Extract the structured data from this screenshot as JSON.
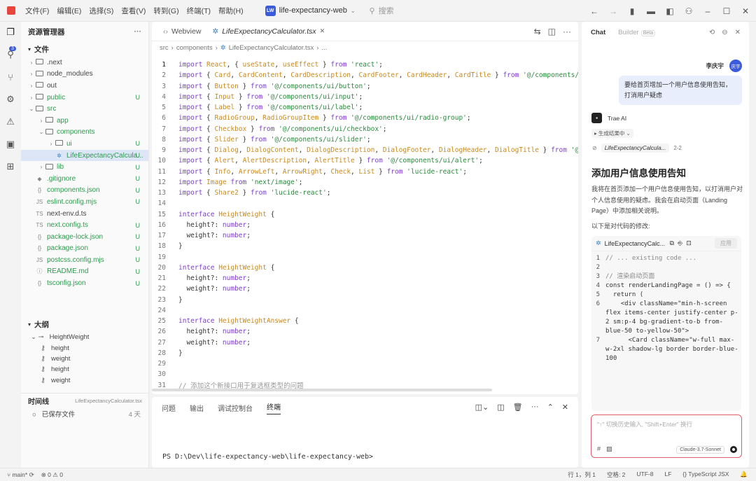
{
  "titlebar": {
    "menus": [
      "文件(F)",
      "编辑(E)",
      "选择(S)",
      "查看(V)",
      "转到(G)",
      "终端(T)",
      "帮助(H)"
    ],
    "project_badge": "LW",
    "project_name": "life-expectancy-web",
    "search_placeholder": "搜索"
  },
  "activity": {
    "badge": "3"
  },
  "sidebar": {
    "title": "资源管理器",
    "files_section": "文件",
    "tree": [
      {
        "name": ".next",
        "type": "folder",
        "indent": 0,
        "status": "",
        "green": false,
        "selected": false
      },
      {
        "name": "node_modules",
        "type": "folder",
        "indent": 0,
        "status": "",
        "green": false,
        "selected": false
      },
      {
        "name": "out",
        "type": "folder",
        "indent": 0,
        "status": "",
        "green": false,
        "selected": false
      },
      {
        "name": "public",
        "type": "folder",
        "indent": 0,
        "status": "U",
        "green": true,
        "selected": false
      },
      {
        "name": "src",
        "type": "folder-open",
        "indent": 0,
        "status": "",
        "green": true,
        "selected": false
      },
      {
        "name": "app",
        "type": "folder",
        "indent": 1,
        "status": "",
        "green": true,
        "selected": false
      },
      {
        "name": "components",
        "type": "folder-open",
        "indent": 1,
        "status": "",
        "green": true,
        "selected": false
      },
      {
        "name": "ui",
        "type": "folder",
        "indent": 2,
        "status": "U",
        "green": true,
        "selected": false
      },
      {
        "name": "LifeExpectancyCalcula...",
        "type": "tsx",
        "indent": 2,
        "status": "U",
        "green": true,
        "selected": true
      },
      {
        "name": "lib",
        "type": "folder",
        "indent": 1,
        "status": "U",
        "green": true,
        "selected": false
      },
      {
        "name": ".gitignore",
        "type": "git",
        "indent": 0,
        "status": "U",
        "green": true,
        "selected": false
      },
      {
        "name": "components.json",
        "type": "json",
        "indent": 0,
        "status": "U",
        "green": true,
        "selected": false
      },
      {
        "name": "eslint.config.mjs",
        "type": "js",
        "indent": 0,
        "status": "U",
        "green": true,
        "selected": false
      },
      {
        "name": "next-env.d.ts",
        "type": "ts",
        "indent": 0,
        "status": "",
        "green": false,
        "selected": false
      },
      {
        "name": "next.config.ts",
        "type": "ts",
        "indent": 0,
        "status": "U",
        "green": true,
        "selected": false
      },
      {
        "name": "package-lock.json",
        "type": "json",
        "indent": 0,
        "status": "U",
        "green": true,
        "selected": false
      },
      {
        "name": "package.json",
        "type": "json",
        "indent": 0,
        "status": "U",
        "green": true,
        "selected": false
      },
      {
        "name": "postcss.config.mjs",
        "type": "js",
        "indent": 0,
        "status": "U",
        "green": true,
        "selected": false
      },
      {
        "name": "README.md",
        "type": "info",
        "indent": 0,
        "status": "U",
        "green": true,
        "selected": false
      },
      {
        "name": "tsconfig.json",
        "type": "json",
        "indent": 0,
        "status": "U",
        "green": true,
        "selected": false
      }
    ],
    "outline_title": "大纲",
    "outline": [
      {
        "name": "HeightWeight",
        "kind": "interface"
      },
      {
        "name": "height",
        "kind": "prop"
      },
      {
        "name": "weight",
        "kind": "prop"
      },
      {
        "name": "height",
        "kind": "prop"
      },
      {
        "name": "weight",
        "kind": "prop"
      }
    ],
    "timeline_title": "时间线",
    "timeline_file": "LifeExpectancyCalculator.tsx",
    "timeline_entry": "已保存文件",
    "timeline_time": "4 天"
  },
  "editor": {
    "tabs": [
      {
        "label": "Webview",
        "active": false
      },
      {
        "label": "LifeExpectancyCalculator.tsx",
        "active": true
      }
    ],
    "breadcrumb": [
      "src",
      "components",
      "LifeExpectancyCalculator.tsx",
      "..."
    ],
    "lines": [
      {
        "n": "1",
        "tokens": [
          [
            "kw",
            "import "
          ],
          [
            "id",
            "React"
          ],
          [
            "pl",
            ", { "
          ],
          [
            "id",
            "useState"
          ],
          [
            "pl",
            ", "
          ],
          [
            "id",
            "useEffect"
          ],
          [
            "pl",
            " } "
          ],
          [
            "kw",
            "from "
          ],
          [
            "st",
            "'react'"
          ],
          [
            "pl",
            ";"
          ]
        ]
      },
      {
        "n": "2",
        "tokens": [
          [
            "kw",
            "import "
          ],
          [
            "pl",
            "{ "
          ],
          [
            "id",
            "Card"
          ],
          [
            "pl",
            ", "
          ],
          [
            "id",
            "CardContent"
          ],
          [
            "pl",
            ", "
          ],
          [
            "id",
            "CardDescription"
          ],
          [
            "pl",
            ", "
          ],
          [
            "id",
            "CardFooter"
          ],
          [
            "pl",
            ", "
          ],
          [
            "id",
            "CardHeader"
          ],
          [
            "pl",
            ", "
          ],
          [
            "id",
            "CardTitle"
          ],
          [
            "pl",
            " } "
          ],
          [
            "kw",
            "from "
          ],
          [
            "st",
            "'@/components/ui"
          ]
        ]
      },
      {
        "n": "3",
        "tokens": [
          [
            "kw",
            "import "
          ],
          [
            "pl",
            "{ "
          ],
          [
            "id",
            "Button"
          ],
          [
            "pl",
            " } "
          ],
          [
            "kw",
            "from "
          ],
          [
            "st",
            "'@/components/ui/button'"
          ],
          [
            "pl",
            ";"
          ]
        ]
      },
      {
        "n": "4",
        "tokens": [
          [
            "kw",
            "import "
          ],
          [
            "pl",
            "{ "
          ],
          [
            "id",
            "Input"
          ],
          [
            "pl",
            " } "
          ],
          [
            "kw",
            "from "
          ],
          [
            "st",
            "'@/components/ui/input'"
          ],
          [
            "pl",
            ";"
          ]
        ]
      },
      {
        "n": "5",
        "tokens": [
          [
            "kw",
            "import "
          ],
          [
            "pl",
            "{ "
          ],
          [
            "id",
            "Label"
          ],
          [
            "pl",
            " } "
          ],
          [
            "kw",
            "from "
          ],
          [
            "st",
            "'@/components/ui/label'"
          ],
          [
            "pl",
            ";"
          ]
        ]
      },
      {
        "n": "6",
        "tokens": [
          [
            "kw",
            "import "
          ],
          [
            "pl",
            "{ "
          ],
          [
            "id",
            "RadioGroup"
          ],
          [
            "pl",
            ", "
          ],
          [
            "id",
            "RadioGroupItem"
          ],
          [
            "pl",
            " } "
          ],
          [
            "kw",
            "from "
          ],
          [
            "st",
            "'@/components/ui/radio-group'"
          ],
          [
            "pl",
            ";"
          ]
        ]
      },
      {
        "n": "7",
        "tokens": [
          [
            "kw",
            "import "
          ],
          [
            "pl",
            "{ "
          ],
          [
            "id",
            "Checkbox"
          ],
          [
            "pl",
            " } "
          ],
          [
            "kw",
            "from "
          ],
          [
            "st",
            "'@/components/ui/checkbox'"
          ],
          [
            "pl",
            ";"
          ]
        ]
      },
      {
        "n": "8",
        "tokens": [
          [
            "kw",
            "import "
          ],
          [
            "pl",
            "{ "
          ],
          [
            "id",
            "Slider"
          ],
          [
            "pl",
            " } "
          ],
          [
            "kw",
            "from "
          ],
          [
            "st",
            "'@/components/ui/slider'"
          ],
          [
            "pl",
            ";"
          ]
        ]
      },
      {
        "n": "9",
        "tokens": [
          [
            "kw",
            "import "
          ],
          [
            "pl",
            "{ "
          ],
          [
            "id",
            "Dialog"
          ],
          [
            "pl",
            ", "
          ],
          [
            "id",
            "DialogContent"
          ],
          [
            "pl",
            ", "
          ],
          [
            "id",
            "DialogDescription"
          ],
          [
            "pl",
            ", "
          ],
          [
            "id",
            "DialogFooter"
          ],
          [
            "pl",
            ", "
          ],
          [
            "id",
            "DialogHeader"
          ],
          [
            "pl",
            ", "
          ],
          [
            "id",
            "DialogTitle"
          ],
          [
            "pl",
            " } "
          ],
          [
            "kw",
            "from "
          ],
          [
            "st",
            "'@/c"
          ]
        ]
      },
      {
        "n": "10",
        "tokens": [
          [
            "kw",
            "import "
          ],
          [
            "pl",
            "{ "
          ],
          [
            "id",
            "Alert"
          ],
          [
            "pl",
            ", "
          ],
          [
            "id",
            "AlertDescription"
          ],
          [
            "pl",
            ", "
          ],
          [
            "id",
            "AlertTitle"
          ],
          [
            "pl",
            " } "
          ],
          [
            "kw",
            "from "
          ],
          [
            "st",
            "'@/components/ui/alert'"
          ],
          [
            "pl",
            ";"
          ]
        ]
      },
      {
        "n": "11",
        "tokens": [
          [
            "kw",
            "import "
          ],
          [
            "pl",
            "{ "
          ],
          [
            "id",
            "Info"
          ],
          [
            "pl",
            ", "
          ],
          [
            "id",
            "ArrowLeft"
          ],
          [
            "pl",
            ", "
          ],
          [
            "id",
            "ArrowRight"
          ],
          [
            "pl",
            ", "
          ],
          [
            "id",
            "Check"
          ],
          [
            "pl",
            ", "
          ],
          [
            "id",
            "List"
          ],
          [
            "pl",
            " } "
          ],
          [
            "kw",
            "from "
          ],
          [
            "st",
            "'lucide-react'"
          ],
          [
            "pl",
            ";"
          ]
        ]
      },
      {
        "n": "12",
        "tokens": [
          [
            "kw",
            "import "
          ],
          [
            "id",
            "Image "
          ],
          [
            "kw",
            "from "
          ],
          [
            "st",
            "'next/image'"
          ],
          [
            "pl",
            ";"
          ]
        ]
      },
      {
        "n": "13",
        "tokens": [
          [
            "kw",
            "import "
          ],
          [
            "pl",
            "{ "
          ],
          [
            "id",
            "Share2"
          ],
          [
            "pl",
            " } "
          ],
          [
            "kw",
            "from "
          ],
          [
            "st",
            "'lucide-react'"
          ],
          [
            "pl",
            ";"
          ]
        ]
      },
      {
        "n": "14",
        "tokens": []
      },
      {
        "n": "15",
        "tokens": [
          [
            "kw",
            "interface "
          ],
          [
            "id",
            "HeightWeight"
          ],
          [
            "pl",
            " {"
          ]
        ]
      },
      {
        "n": "16",
        "tokens": [
          [
            "pl",
            "  height?: "
          ],
          [
            "ty",
            "number"
          ],
          [
            "pl",
            ";"
          ]
        ]
      },
      {
        "n": "17",
        "tokens": [
          [
            "pl",
            "  weight?: "
          ],
          [
            "ty",
            "number"
          ],
          [
            "pl",
            ";"
          ]
        ]
      },
      {
        "n": "18",
        "tokens": [
          [
            "pl",
            "}"
          ]
        ]
      },
      {
        "n": "19",
        "tokens": []
      },
      {
        "n": "20",
        "tokens": [
          [
            "kw",
            "interface "
          ],
          [
            "id",
            "HeightWeight"
          ],
          [
            "pl",
            " {"
          ]
        ]
      },
      {
        "n": "21",
        "tokens": [
          [
            "pl",
            "  height?: "
          ],
          [
            "ty",
            "number"
          ],
          [
            "pl",
            ";"
          ]
        ]
      },
      {
        "n": "22",
        "tokens": [
          [
            "pl",
            "  weight?: "
          ],
          [
            "ty",
            "number"
          ],
          [
            "pl",
            ";"
          ]
        ]
      },
      {
        "n": "23",
        "tokens": [
          [
            "pl",
            "}"
          ]
        ]
      },
      {
        "n": "24",
        "tokens": []
      },
      {
        "n": "25",
        "tokens": [
          [
            "kw",
            "interface "
          ],
          [
            "id",
            "HeightWeightAnswer"
          ],
          [
            "pl",
            " {"
          ]
        ]
      },
      {
        "n": "26",
        "tokens": [
          [
            "pl",
            "  height?: "
          ],
          [
            "ty",
            "number"
          ],
          [
            "pl",
            ";"
          ]
        ]
      },
      {
        "n": "27",
        "tokens": [
          [
            "pl",
            "  weight?: "
          ],
          [
            "ty",
            "number"
          ],
          [
            "pl",
            ";"
          ]
        ]
      },
      {
        "n": "28",
        "tokens": [
          [
            "pl",
            "}"
          ]
        ]
      },
      {
        "n": "29",
        "tokens": []
      },
      {
        "n": "30",
        "tokens": []
      },
      {
        "n": "31",
        "tokens": [
          [
            "cm",
            "// 添加这个新接口用于复选框类型的问题"
          ]
        ]
      }
    ]
  },
  "panel": {
    "tabs": [
      "问题",
      "输出",
      "调试控制台",
      "终端"
    ],
    "active_tab": "终端",
    "prompt": "PS D:\\Dev\\life-expectancy-web\\life-expectancy-web>"
  },
  "chat": {
    "tab_chat": "Chat",
    "tab_builder": "Builder",
    "beta": "Beta",
    "user_name": "李庆宇",
    "user_avatar": "庆宇",
    "user_message": "要给首页增加一个用户信息使用告知，打消用户疑虑",
    "ai_name": "Trae AI",
    "generating": "生成结果中",
    "file_ref": "LifeExpectancyCalcula...",
    "file_ref_lines": "2-2",
    "heading": "添加用户信息使用告知",
    "para": "我将在首页添加一个用户信息使用告知，以打消用户对个人信息使用的疑虑。我会在启动页面（Landing Page）中添加相关说明。",
    "para2": "以下是对代码的修改:",
    "code_title": "LifeExpectancyCalc...",
    "apply": "应用",
    "code_lines": [
      {
        "n": "1",
        "text": "// ... existing code ..."
      },
      {
        "n": "2",
        "text": ""
      },
      {
        "n": "3",
        "text": "// 渲染启动页面"
      },
      {
        "n": "4",
        "text": "const renderLandingPage = () => {"
      },
      {
        "n": "5",
        "text": "  return ("
      },
      {
        "n": "6",
        "text": "    <div className=\"min-h-screen flex items-center justify-center p-2 sm:p-4 bg-gradient-to-b from-blue-50 to-yellow-50\">"
      },
      {
        "n": "7",
        "text": "      <Card className=\"w-full max-w-2xl shadow-lg border border-blue-100"
      }
    ],
    "input_placeholder": "\"↑\" 切换历史输入, \"Shift+Enter\" 换行",
    "model": "Claude-3.7-Sonnet"
  },
  "statusbar": {
    "branch": "main*",
    "errors": "0",
    "warnings": "0",
    "position": "行 1，列 1",
    "spaces": "空格: 2",
    "encoding": "UTF-8",
    "eol": "LF",
    "language": "TypeScript JSX"
  }
}
